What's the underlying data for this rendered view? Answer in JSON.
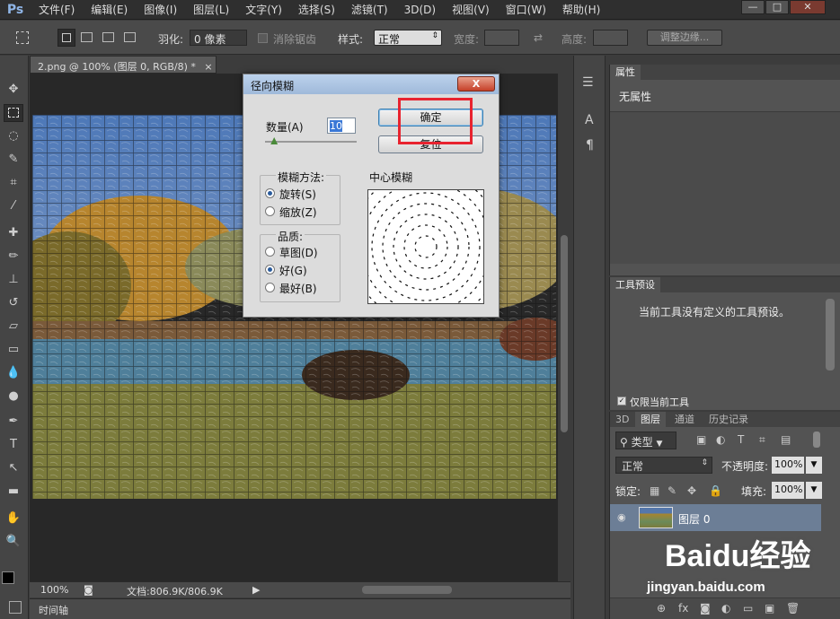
{
  "app": {
    "logo": "Ps"
  },
  "menu": {
    "items": [
      "文件(F)",
      "编辑(E)",
      "图像(I)",
      "图层(L)",
      "文字(Y)",
      "选择(S)",
      "滤镜(T)",
      "3D(D)",
      "视图(V)",
      "窗口(W)",
      "帮助(H)"
    ]
  },
  "window_controls": {
    "minimize": "—",
    "restore": "□",
    "close": "✕"
  },
  "options": {
    "feather_label": "羽化:",
    "feather_value": "0 像素",
    "antialias_label": "消除锯齿",
    "style_label": "样式:",
    "style_value": "正常",
    "width_label": "宽度:",
    "height_label": "高度:",
    "refine_edge": "调整边缘..."
  },
  "document": {
    "tab_title": "2.png @ 100% (图层 0, RGB/8) *",
    "tab_close": "×"
  },
  "status": {
    "zoom": "100%",
    "doc_info": "文档:806.9K/806.9K"
  },
  "timeline": {
    "label": "时间轴"
  },
  "dialog": {
    "title": "径向模糊",
    "close": "X",
    "amount_label": "数量(A)",
    "amount_value": "10",
    "amount_fraction": 0.1,
    "ok": "确定",
    "reset": "复位",
    "method_label": "模糊方法:",
    "method_spin": "旋转(S)",
    "method_zoom": "缩放(Z)",
    "quality_label": "品质:",
    "quality_draft": "草图(D)",
    "quality_good": "好(G)",
    "quality_best": "最好(B)",
    "center_label": "中心模糊"
  },
  "properties": {
    "tab": "属性",
    "content": "无属性"
  },
  "tool_presets": {
    "tab": "工具预设",
    "content": "当前工具没有定义的工具预设。",
    "checkbox_label": "仅限当前工具"
  },
  "layers": {
    "tabs": [
      "3D",
      "图层",
      "通道",
      "历史记录"
    ],
    "filter_type": "类型",
    "blend_mode": "正常",
    "opacity_label": "不透明度:",
    "opacity_value": "100%",
    "lock_label": "锁定:",
    "fill_label": "填充:",
    "fill_value": "100%",
    "layer_name": "图层 0",
    "footer_icons": [
      "⊕",
      "fx",
      "◙",
      "◐",
      "▭",
      "▣",
      "🗑"
    ]
  },
  "watermark": {
    "brand": "Baidu经验",
    "url": "jingyan.baidu.com"
  }
}
